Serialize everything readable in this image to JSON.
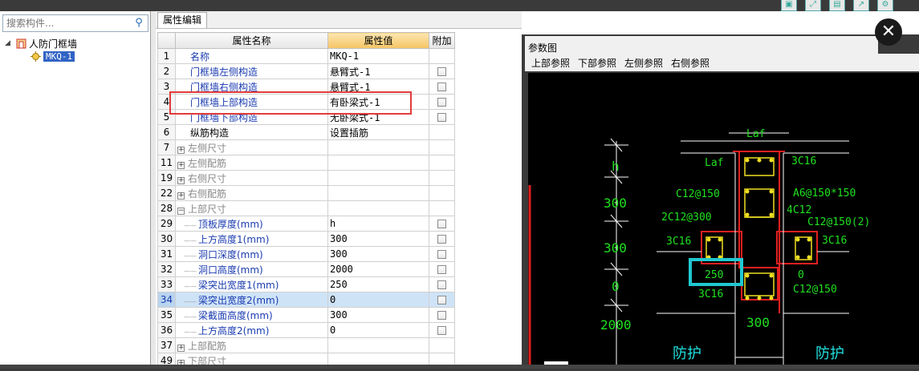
{
  "search": {
    "placeholder": "搜索构件..."
  },
  "tree": {
    "root_label": "人防门框墙",
    "child_label": "MKQ-1"
  },
  "prop_tab": "属性编辑",
  "table": {
    "headers": [
      "属性名称",
      "属性值",
      "附加"
    ],
    "rows": [
      {
        "num": "1",
        "name": "名称",
        "value": "MKQ-1",
        "style": "blue",
        "check": false
      },
      {
        "num": "2",
        "name": "门框墙左侧构造",
        "value": "悬臂式-1",
        "style": "blue",
        "check": true
      },
      {
        "num": "3",
        "name": "门框墙右侧构造",
        "value": "悬臂式-1",
        "style": "blue",
        "check": true
      },
      {
        "num": "4",
        "name": "门框墙上部构造",
        "value": "有卧梁式-1",
        "style": "blue",
        "check": true
      },
      {
        "num": "5",
        "name": "门框墙下部构造",
        "value": "无卧梁式-1",
        "style": "blue",
        "check": true
      },
      {
        "num": "6",
        "name": "纵筋构造",
        "value": "设置插筋",
        "style": "",
        "check": false
      },
      {
        "num": "7",
        "name": "左侧尺寸",
        "value": "",
        "style": "gray",
        "group": "+",
        "check": false
      },
      {
        "num": "11",
        "name": "左侧配筋",
        "value": "",
        "style": "gray",
        "group": "+",
        "check": false
      },
      {
        "num": "19",
        "name": "右侧尺寸",
        "value": "",
        "style": "gray",
        "group": "+",
        "check": false
      },
      {
        "num": "22",
        "name": "右侧配筋",
        "value": "",
        "style": "gray",
        "group": "+",
        "check": false
      },
      {
        "num": "28",
        "name": "上部尺寸",
        "value": "",
        "style": "gray",
        "group": "-",
        "check": false
      },
      {
        "num": "29",
        "name": "顶板厚度(mm)",
        "value": "h",
        "style": "blue",
        "indent": true,
        "check": true
      },
      {
        "num": "30",
        "name": "上方高度1(mm)",
        "value": "300",
        "style": "blue",
        "indent": true,
        "check": true
      },
      {
        "num": "31",
        "name": "洞口深度(mm)",
        "value": "300",
        "style": "blue",
        "indent": true,
        "check": true
      },
      {
        "num": "32",
        "name": "洞口高度(mm)",
        "value": "2000",
        "style": "blue",
        "indent": true,
        "check": true
      },
      {
        "num": "33",
        "name": "梁突出宽度1(mm)",
        "value": "250",
        "style": "blue",
        "indent": true,
        "check": true
      },
      {
        "num": "34",
        "name": "梁突出宽度2(mm)",
        "value": "0",
        "style": "blue",
        "indent": true,
        "check": true,
        "selected": true
      },
      {
        "num": "35",
        "name": "梁截面高度(mm)",
        "value": "300",
        "style": "blue",
        "indent": true,
        "check": true
      },
      {
        "num": "36",
        "name": "上方高度2(mm)",
        "value": "0",
        "style": "blue",
        "indent": true,
        "check": true
      },
      {
        "num": "37",
        "name": "上部配筋",
        "value": "",
        "style": "gray",
        "group": "+",
        "check": false
      },
      {
        "num": "49",
        "name": "下部尺寸",
        "value": "",
        "style": "gray",
        "group": "+",
        "check": false
      }
    ]
  },
  "diagram": {
    "title": "参数图",
    "menu": [
      "上部参照",
      "下部参照",
      "左侧参照",
      "右侧参照"
    ],
    "labels": {
      "laf_top": "Laf",
      "laf_left": "Laf",
      "c3c16_top": "3C16",
      "c12_150_left": "C12@150",
      "a6": "A6@150*150",
      "c4c12": "4C12",
      "c2c12_300": "2C12@300",
      "c12_150_2": "C12@150(2)",
      "c3c16_left": "3C16",
      "c3c16_right": "3C16",
      "d250": "250",
      "d0": "0",
      "c12_150_right": "C12@150",
      "c3c16_bot": "3C16",
      "dim_h": "h",
      "dim_300a": "300",
      "dim_300b": "300",
      "dim_0": "0",
      "dim_2000": "2000",
      "dim_300c": "300",
      "fh1": "防护",
      "fh2": "防护"
    }
  },
  "close_icon": "close-icon"
}
